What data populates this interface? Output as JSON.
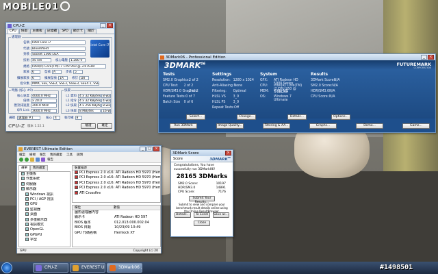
{
  "watermark_logo": "MOBILE01",
  "watermark_id": "#1498501",
  "cpuz": {
    "title": "CPU-Z",
    "tabs": [
      "CPU",
      "快取",
      "主機板",
      "記憶體",
      "SPD",
      "顯示卡",
      "關於"
    ],
    "processor_group": "處理器",
    "rows": [
      {
        "label": "名稱",
        "value": "Intel Core i7"
      },
      {
        "label": "代號",
        "value": "Bloomfield"
      },
      {
        "label": "封裝",
        "value": "Socket 1366 LGA"
      },
      {
        "label": "技術",
        "value": "45 nm",
        "label2": "核心電壓",
        "value2": "1.280 V"
      },
      {
        "label": "規格",
        "value": "Intel(R) Core(TM) i7 CPU   950  @ 3.07GHz"
      },
      {
        "label": "家族",
        "value": "6",
        "label2": "型號",
        "value2": "A",
        "label3": "步進",
        "value3": "5"
      },
      {
        "label": "擴展家族",
        "value": "6",
        "label2": "擴展型號",
        "value2": "1A",
        "label3": "修訂",
        "value3": "D0"
      },
      {
        "label": "指令集",
        "value": "MMX, SSE, SSE2, SSE3, SSSE3, SSE4.1, SSE4.2, EM64T"
      }
    ],
    "clocks_group": "時脈 (核心 #0)",
    "clocks": [
      {
        "label": "核心速度",
        "value": "4000.0 MHz"
      },
      {
        "label": "倍頻",
        "value": "x 20.0"
      },
      {
        "label": "匯流排速度",
        "value": "200.0 MHz"
      },
      {
        "label": "QPI Link",
        "value": "3600.0 MHz"
      }
    ],
    "cache_group": "快取",
    "cache": [
      {
        "label": "L1 資料",
        "value": "4 x 32 KBytes",
        "way": "8-way"
      },
      {
        "label": "L1 指令",
        "value": "4 x 32 KBytes",
        "way": "4-way"
      },
      {
        "label": "L2 快取",
        "value": "4 x 256 KBytes",
        "way": "8-way"
      },
      {
        "label": "L3 快取",
        "value": "8 MBytes",
        "way": "16-way"
      }
    ],
    "selection_label": "選擇",
    "selection_value": "處理器 #1",
    "cores_label": "核心",
    "cores_value": "4",
    "threads_label": "執行緒",
    "threads_value": "8",
    "version": "版本 1.52.1",
    "logo_label": "CPU-Z",
    "ok_label": "確定",
    "validate_label": "驗證",
    "badge": "intel Core i7"
  },
  "mark": {
    "title": "3DMark06 - Professional Edition",
    "brand": "3DMARK",
    "brand_sup": "06",
    "futuremark": "FUTUREMARK",
    "futuremark_sub": "CORPORATION",
    "tests": {
      "title": "Tests",
      "rows": [
        {
          "k": "SM2.0 Graphics:",
          "v": "2 of 2"
        },
        {
          "k": "CPU Test:",
          "v": "2 of 2"
        },
        {
          "k": "HDR/SM3.0 Graphics:",
          "v": "2 of 2"
        },
        {
          "k": "Feature Tests:",
          "v": "0 of 7"
        },
        {
          "k": "Batch Size",
          "v": "0 of 6"
        }
      ]
    },
    "settings": {
      "title": "Settings",
      "rows": [
        {
          "k": "Resolution:",
          "v": "1280 x 1024"
        },
        {
          "k": "Anti-Aliasing:",
          "v": "None"
        },
        {
          "k": "Filtering:",
          "v": "Optimal"
        },
        {
          "k": "HLSL VS",
          "v": "3_0"
        },
        {
          "k": "HLSL PS",
          "v": "3_0"
        },
        {
          "k": "Repeat Tests:",
          "v": "Off"
        }
      ]
    },
    "system": {
      "title": "System",
      "rows": [
        {
          "k": "GFX:",
          "v": "ATI Radeon HD 5900 Series"
        },
        {
          "k": "CPU:",
          "v": "Intel(R) Core(TM) i7 CPU 950 @ 3.06GHz"
        },
        {
          "k": "MEM:",
          "v": "4090 MB"
        },
        {
          "k": "OS:",
          "v": "Windows 7 Ultimate"
        }
      ]
    },
    "results": {
      "title": "Results",
      "rows": [
        {
          "k": "3DMark Score:",
          "v": "N/A"
        },
        {
          "k": "SM2.0 Score:",
          "v": "N/A"
        },
        {
          "k": "HDR/SM3.0",
          "v": "N/A"
        },
        {
          "k": "CPU Score:",
          "v": "N/A"
        }
      ]
    },
    "select_label": "Select...",
    "change_label": "Change...",
    "details_label": "Details...",
    "options_label": "Options...",
    "bottom_buttons": [
      "Run 3DMark",
      "Image Quality...",
      "Filtering & AA...",
      "Graphs...",
      "Demo...",
      "Game..."
    ]
  },
  "everest": {
    "title": "EVEREST Ultimate Edition",
    "menu": [
      "檔案",
      "檢視",
      "報告",
      "我的最愛",
      "工具",
      "說明"
    ],
    "toolbar_report": "報告",
    "tabs": [
      "選單",
      "我的最愛"
    ],
    "tree": [
      "主機板",
      "作業系統",
      "伺服器",
      "顯示器",
      "Windows 視訊",
      "PCI / AGP 視訊",
      "GPU",
      "監視器",
      "桌面",
      "多重顯示器",
      "視訊模式",
      "OpenGL",
      "GPGPU",
      "字型"
    ],
    "list_header": "裝置描述",
    "list_items": [
      "PCI Express 2.0 x16: ATI Radeon HD 5970 (Hemlock)",
      "PCI Express 2.0 x16: ATI Radeon HD 5970 (Hemlock)",
      "PCI Express 2.0 x16: ATI Radeon HD 5970 (Hemlock)",
      "PCI Express 2.0 x16: ATI Radeon HD 5970 (Hemlock)",
      "ATI Crossfire"
    ],
    "props_header_field": "欄位",
    "props_header_value": "數值",
    "props": [
      {
        "k": "圖形處理器內容",
        "v": ""
      },
      {
        "k": "顯示卡",
        "v": "ATI Radeon HD 597"
      },
      {
        "k": "BIOS 版本",
        "v": "012.013.000.002.04"
      },
      {
        "k": "BIOS 日期",
        "v": "10/23/09 10:49"
      },
      {
        "k": "GPU 代碼名稱",
        "v": "Hemlock XT"
      }
    ],
    "status": "GPU",
    "copyright": "Copyright (c) 20"
  },
  "score": {
    "title": "3DMark Score",
    "header": "Score",
    "brand": "3DMARK",
    "brand_sup": "06",
    "congrats": "Congratulations, You have succesfully run 3DMark06!",
    "value": "28165 3DMarks",
    "rows": [
      {
        "k": "SM2.0 Score:",
        "v": "10197"
      },
      {
        "k": "HDR/SM3.0",
        "v": "14891"
      },
      {
        "k": "CPU Score:",
        "v": "7176"
      }
    ],
    "submit_label": "Submit Your Results...",
    "note": "Submit to view and compare your benchmark result details online using the Online ResultBrowser.",
    "details_label": "Details...",
    "to_excel_label": "To Excel",
    "save_as_label": "Save as...",
    "close_label": "Close"
  },
  "taskbar": {
    "items": [
      {
        "label": "CPU-Z",
        "color": "#7a6bd8"
      },
      {
        "label": "EVEREST Ult...",
        "color": "#e0a030"
      },
      {
        "label": "3DMark06 ...",
        "color": "#e06a20"
      }
    ]
  },
  "colors": {
    "mark_blue": "#1e4f8c",
    "mark_band": "#3d74b8",
    "win_border": "#6a8fb8"
  }
}
